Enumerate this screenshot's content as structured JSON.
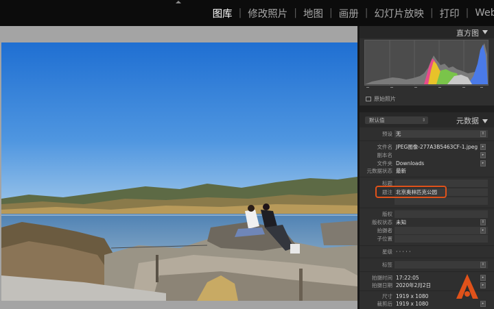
{
  "modules": {
    "library": "图库",
    "develop": "修改照片",
    "map": "地图",
    "book": "画册",
    "slideshow": "幻灯片放映",
    "print": "打印",
    "web": "Web",
    "separator": "|"
  },
  "histogram": {
    "title": "直方图",
    "original_photo_label": "原始照片"
  },
  "metadata": {
    "preset_dropdown": "默认值",
    "title": "元数据",
    "preset": {
      "label": "预设",
      "value": "无"
    },
    "filename": {
      "label": "文件名",
      "value": "JPEG图像-277A3B5463CF-1.jpeg"
    },
    "copy_name": {
      "label": "副本名",
      "value": ""
    },
    "folder": {
      "label": "文件夹",
      "value": "Downloads"
    },
    "metadata_status": {
      "label": "元数据状态",
      "value": "最新"
    },
    "caption_title": {
      "label": "标题",
      "value": ""
    },
    "caption": {
      "label": "题注",
      "value": "北京奥林匹克公园"
    },
    "copyright": {
      "label": "版权",
      "value": ""
    },
    "copyright_status": {
      "label": "版权状态",
      "value": "未知"
    },
    "creator": {
      "label": "拍摄者",
      "value": ""
    },
    "sublocation": {
      "label": "子位置",
      "value": ""
    },
    "rating": {
      "label": "星级",
      "value": "· · · · ·"
    },
    "label": {
      "label": "标签",
      "value": ""
    },
    "capture_time": {
      "label": "拍摄时间",
      "value": "17:22:05"
    },
    "capture_date": {
      "label": "拍摄日期",
      "value": "2020年2月2日"
    },
    "dimensions": {
      "label": "尺寸",
      "value": "1919 x 1080"
    },
    "cropped": {
      "label": "裁剪后",
      "value": "1919 x 1080"
    }
  },
  "colors": {
    "highlight_border": "#e0521a",
    "logo": "#e0521a"
  },
  "icons": {
    "top_collapse": "triangle-up-icon",
    "panel_collapse": "triangle-down-icon",
    "logo": "adobe-a-logo-icon"
  }
}
